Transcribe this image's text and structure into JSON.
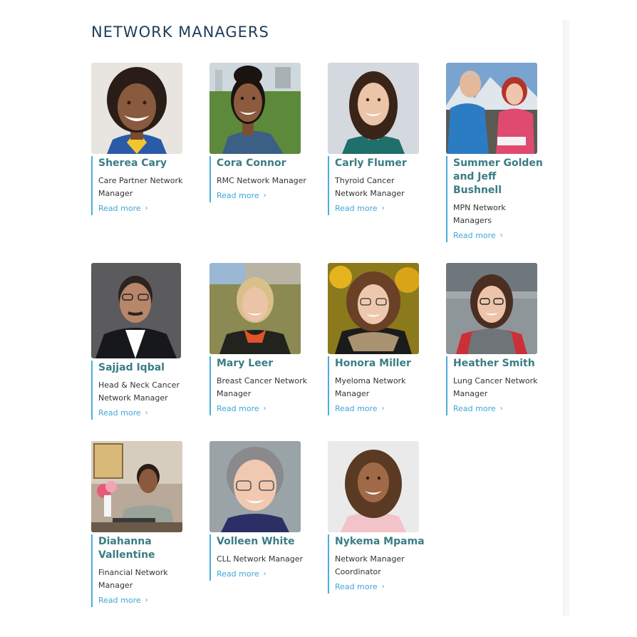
{
  "page": {
    "title": "NETWORK MANAGERS"
  },
  "colors": {
    "title": "#1d3d5a",
    "name": "#3a7d84",
    "accent_bar": "#49aee0",
    "link": "#3fa6d8"
  },
  "managers": [
    {
      "name": "Sherea Cary",
      "role": "Care Partner Network Manager",
      "link": "Read more",
      "icon": "chevron-right-icon"
    },
    {
      "name": "Cora Connor",
      "role": "RMC Network Manager",
      "link": "Read more",
      "icon": "chevron-right-icon"
    },
    {
      "name": "Carly Flumer",
      "role": "Thyroid Cancer Network Manager",
      "link": "Read more",
      "icon": "chevron-right-icon"
    },
    {
      "name": "Summer Golden and Jeff Bushnell",
      "role": "MPN Network Managers",
      "link": "Read more",
      "icon": "chevron-right-icon"
    },
    {
      "name": "Sajjad Iqbal",
      "role": "Head & Neck Cancer Network Manager",
      "link": "Read more",
      "icon": "chevron-right-icon"
    },
    {
      "name": "Mary Leer",
      "role": "Breast Cancer Network Manager",
      "link": "Read more",
      "icon": "chevron-right-icon"
    },
    {
      "name": "Honora Miller",
      "role": "Myeloma Network Manager",
      "link": "Read more",
      "icon": "chevron-right-icon"
    },
    {
      "name": "Heather Smith",
      "role": "Lung Cancer Network Manager",
      "link": "Read more",
      "icon": "chevron-right-icon"
    },
    {
      "name": "Diahanna Vallentine",
      "role": "Financial Network Manager",
      "link": "Read more",
      "icon": "chevron-right-icon"
    },
    {
      "name": "Volleen White",
      "role": "CLL Network Manager",
      "link": "Read more",
      "icon": "chevron-right-icon"
    },
    {
      "name": "Nykema Mpama",
      "role": "Network Manager Coordinator",
      "link": "Read more",
      "icon": "chevron-right-icon"
    }
  ]
}
